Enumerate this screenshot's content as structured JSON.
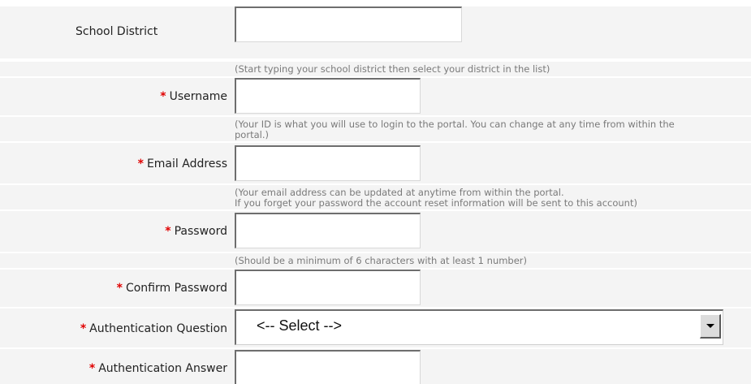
{
  "form": {
    "school_district": {
      "label": "School District",
      "value": "",
      "hint": "(Start typing your school district then select your district in the list)"
    },
    "username": {
      "required_marker": "*",
      "label": "Username",
      "value": "",
      "hint_line1": "(Your ID is what you will use to login to the portal. You can change at any time from within the",
      "hint_line2": "portal.)"
    },
    "email": {
      "required_marker": "*",
      "label": "Email Address",
      "value": "",
      "hint_line1": "(Your email address can be updated at anytime from within the portal.",
      "hint_line2": "If you forget your password the account reset information will be sent to this account)"
    },
    "password": {
      "required_marker": "*",
      "label": "Password",
      "value": "",
      "hint": "(Should be a minimum of 6 characters with at least 1 number)"
    },
    "confirm_password": {
      "required_marker": "*",
      "label": "Confirm Password",
      "value": ""
    },
    "auth_question": {
      "required_marker": "*",
      "label": "Authentication Question",
      "selected": "<-- Select -->",
      "icon": "chevron-down-icon"
    },
    "auth_answer": {
      "required_marker": "*",
      "label": "Authentication Answer",
      "value": ""
    }
  },
  "colors": {
    "required": "#e00000",
    "hint": "#7a7a7a",
    "band": "#f4f4f4"
  }
}
